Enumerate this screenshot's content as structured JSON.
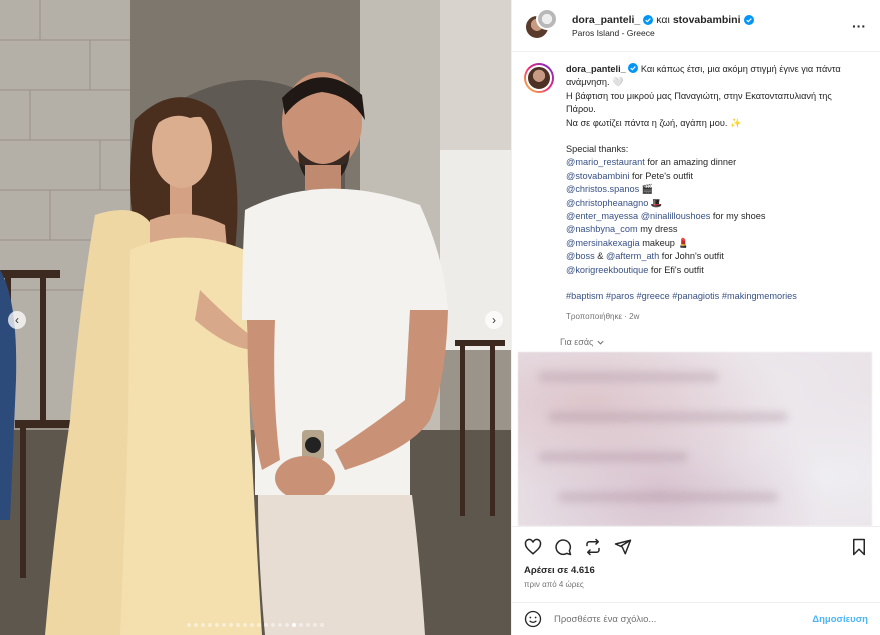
{
  "header": {
    "user1": "dora_panteli_",
    "connector": "και",
    "user2": "stovabambini",
    "location": "Paros Island - Greece"
  },
  "caption": {
    "username": "dora_panteli_",
    "line1": "Και κάπως έτσι, μια ακόμη στιγμή έγινε για πάντα ανάμνηση. 🤍",
    "line2": "Η βάφτιση του μικρού μας Παναγιώτη, στην Εκατονταπυλιανή της Πάρου.",
    "line3": "Να σε φωτίζει πάντα η ζωή, αγάπη μου. ✨",
    "thanks_title": "Special thanks:",
    "thanks": [
      {
        "handle": "@mario_restaurant",
        "text": " for an amazing dinner"
      },
      {
        "handle": "@stovabambini",
        "text": " for Pete's outfit"
      },
      {
        "handle": "@christos.spanos",
        "text": " 🎬"
      },
      {
        "handle": "@christopheanagno",
        "text": " 🎩"
      },
      {
        "handle": "@enter_mayessa",
        "handle2": "@ninalilloushoes",
        "text": " for my shoes"
      },
      {
        "handle": "@nashbyna_com",
        "text": " my dress"
      },
      {
        "handle": "@mersinakexagia",
        "text": " makeup 💄"
      },
      {
        "handle": "@boss",
        "mid": " & ",
        "handle2": "@afterm_ath",
        "text": " for John's outfit"
      },
      {
        "handle": "@korigreekboutique",
        "text": " for Efi's outfit"
      }
    ],
    "hashtags": "#baptism #paros #greece #panagiotis #makingmemories",
    "edited": "Τροποποιήθηκε · 2w"
  },
  "for_you": "Για εσάς",
  "likes": "Αρέσει σε 4.616",
  "time": "πριν από 4 ώρες",
  "comment": {
    "placeholder": "Προσθέστε ένα σχόλιο...",
    "post_label": "Δημοσίευση"
  },
  "carousel": {
    "count": 20,
    "active": 15
  },
  "icons": {
    "more": "more-options-icon",
    "like": "heart-icon",
    "comment": "comment-icon",
    "repost": "repost-icon",
    "share": "share-icon",
    "save": "bookmark-icon",
    "emoji": "emoji-icon"
  },
  "colors": {
    "link": "#385185",
    "verified": "#0095f6",
    "post_button": "#4cb5f9",
    "dress": "#f4dfae"
  }
}
